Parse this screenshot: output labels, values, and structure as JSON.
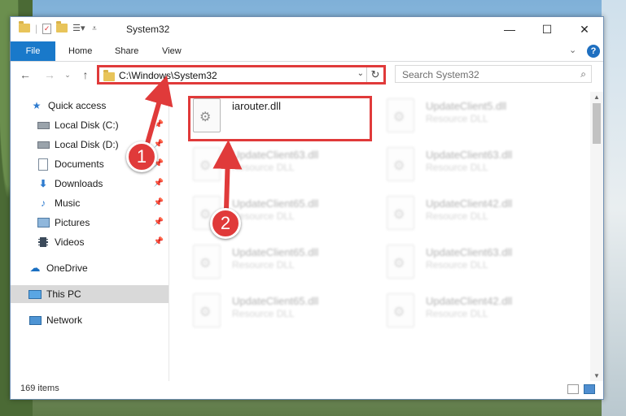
{
  "window": {
    "title": "System32",
    "controls": [
      "minimize",
      "maximize",
      "close"
    ]
  },
  "ribbon": {
    "tabs": [
      "File",
      "Home",
      "Share",
      "View"
    ]
  },
  "address": {
    "path": "C:\\Windows\\System32"
  },
  "search": {
    "placeholder": "Search System32"
  },
  "sidebar": {
    "items": [
      {
        "label": "Quick access",
        "icon": "star-icon",
        "pinned": false
      },
      {
        "label": "Local Disk (C:)",
        "icon": "drive-icon",
        "pinned": true
      },
      {
        "label": "Local Disk (D:)",
        "icon": "drive-icon",
        "pinned": true
      },
      {
        "label": "Documents",
        "icon": "documents-icon",
        "pinned": true
      },
      {
        "label": "Downloads",
        "icon": "download-icon",
        "pinned": true
      },
      {
        "label": "Music",
        "icon": "music-icon",
        "pinned": true
      },
      {
        "label": "Pictures",
        "icon": "pictures-icon",
        "pinned": true
      },
      {
        "label": "Videos",
        "icon": "videos-icon",
        "pinned": true
      },
      {
        "label": "OneDrive",
        "icon": "cloud-icon",
        "pinned": false
      },
      {
        "label": "This PC",
        "icon": "computer-icon",
        "pinned": false,
        "selected": true
      },
      {
        "label": "Network",
        "icon": "network-icon",
        "pinned": false
      }
    ]
  },
  "files": [
    {
      "name": "iarouter.dll",
      "type": ""
    },
    {
      "name": "UpdateClient5.dll",
      "type": "Resource DLL"
    },
    {
      "name": "UpdateClient63.dll",
      "type": "Resource DLL"
    },
    {
      "name": "UpdateClient63.dll",
      "type": "Resource DLL"
    },
    {
      "name": "UpdateClient65.dll",
      "type": "Resource DLL"
    },
    {
      "name": "UpdateClient42.dll",
      "type": "Resource DLL"
    },
    {
      "name": "UpdateClient65.dll",
      "type": "Resource DLL"
    },
    {
      "name": "UpdateClient63.dll",
      "type": "Resource DLL"
    },
    {
      "name": "UpdateClient65.dll",
      "type": "Resource DLL"
    },
    {
      "name": "UpdateClient42.dll",
      "type": "Resource DLL"
    }
  ],
  "status": {
    "item_count": "169 items"
  },
  "annotations": {
    "step1": "1",
    "step2": "2",
    "color": "#e03a3a"
  }
}
